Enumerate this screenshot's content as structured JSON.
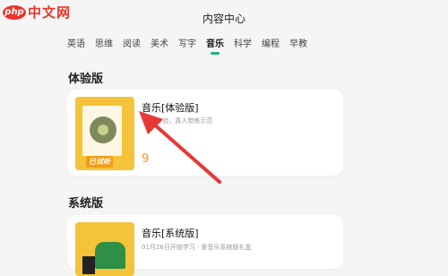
{
  "logo": {
    "badge": "php",
    "text": "中文网"
  },
  "header": {
    "title": "内容中心"
  },
  "tabs": [
    {
      "label": "英语"
    },
    {
      "label": "思维"
    },
    {
      "label": "阅读"
    },
    {
      "label": "美术"
    },
    {
      "label": "写字"
    },
    {
      "label": "音乐",
      "active": true
    },
    {
      "label": "科学"
    },
    {
      "label": "编程"
    },
    {
      "label": "早教"
    }
  ],
  "sections": [
    {
      "title": "体验版",
      "card": {
        "title": "音乐[体验版]",
        "subtitle": "·优先体验，真人带练示范",
        "cover_tag": "已试听",
        "count": "9"
      }
    },
    {
      "title": "系统版",
      "card": {
        "title": "音乐[系统版]",
        "subtitle": "01月26日开始学习 · 爱音乐系统版礼盒"
      }
    }
  ],
  "colors": {
    "accent": "#1db372",
    "arrow": "#e53935",
    "count": "#f39c12"
  }
}
